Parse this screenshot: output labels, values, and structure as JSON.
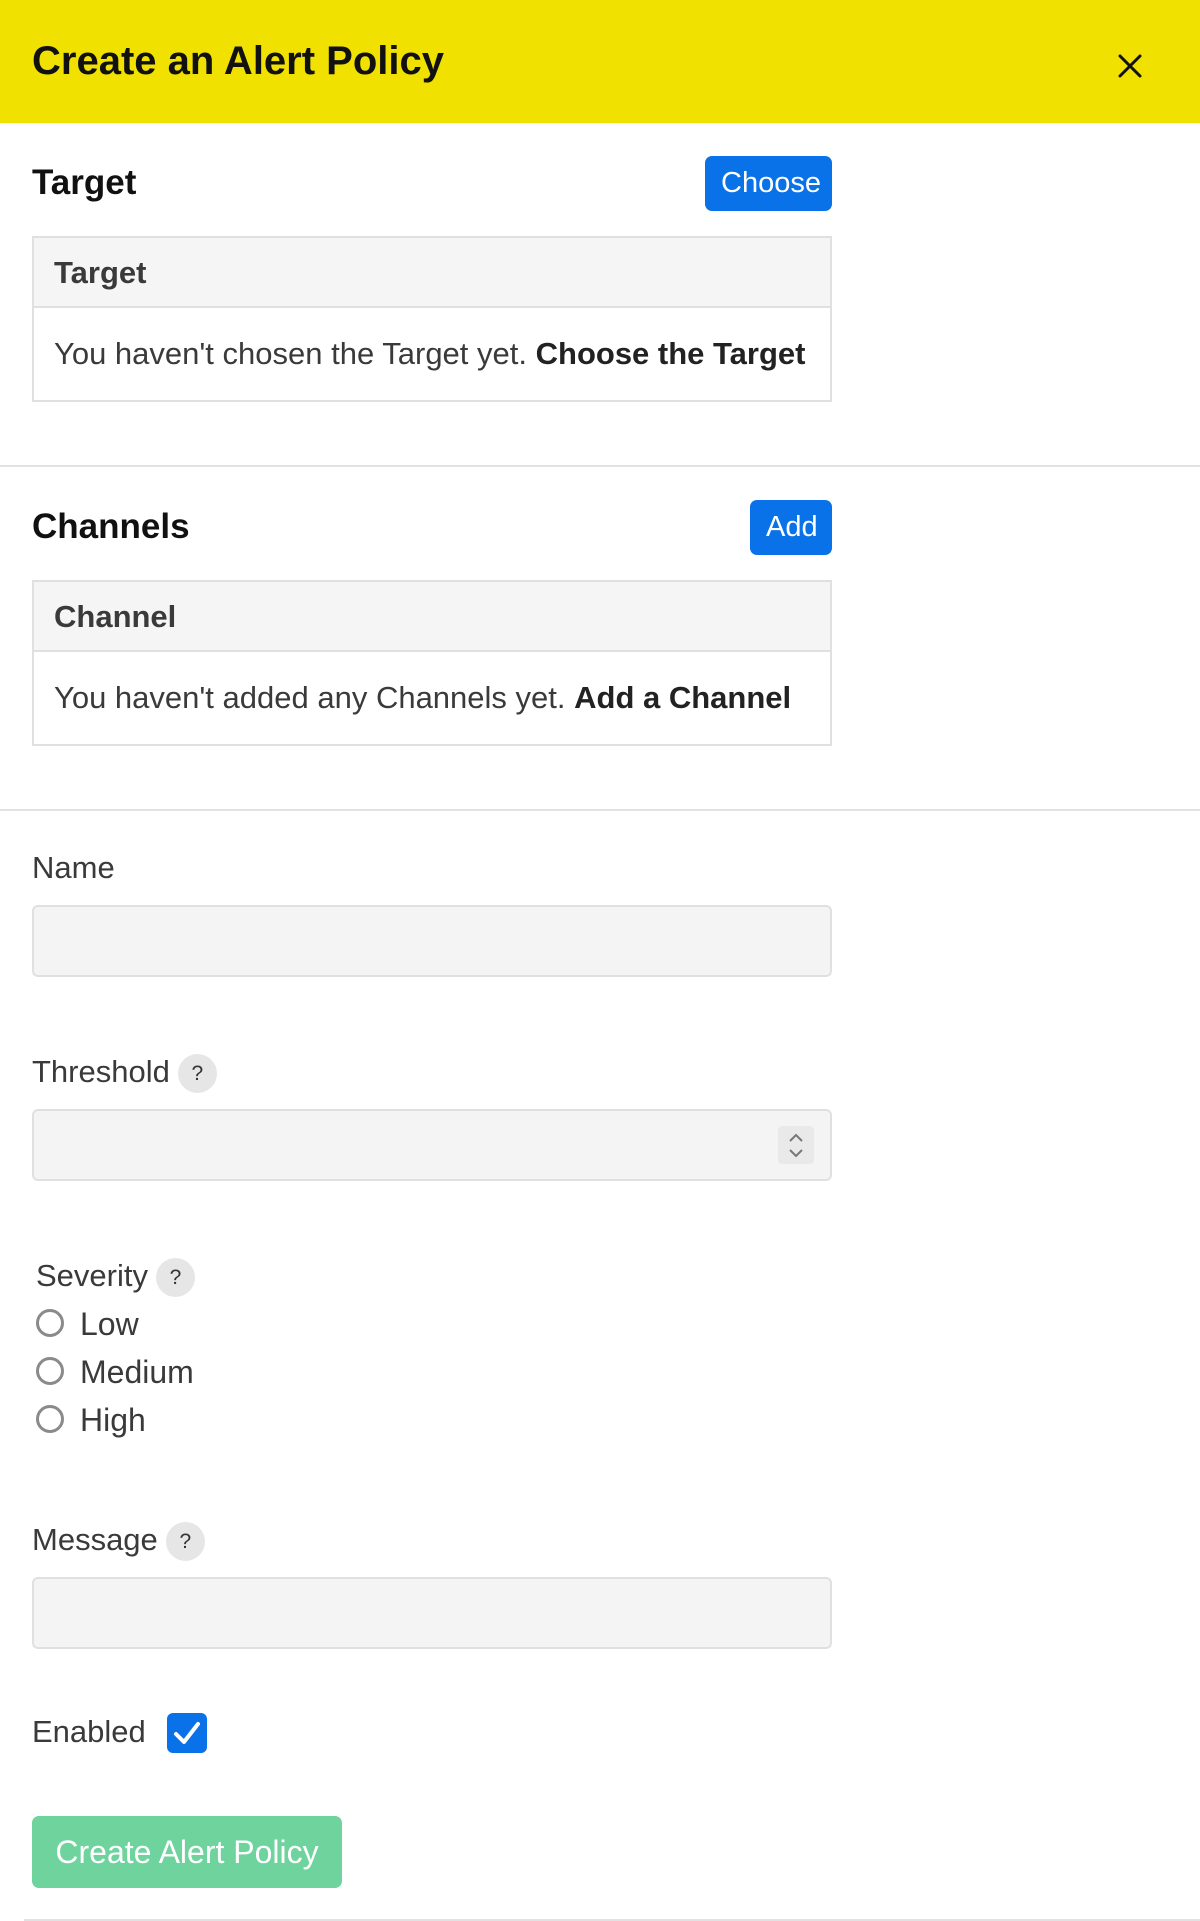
{
  "header": {
    "title": "Create an Alert Policy",
    "close_icon": "close-icon",
    "background_color": "#f1e100"
  },
  "target": {
    "heading": "Target",
    "button_label": "Choose",
    "table_header": "Target",
    "empty_text": "You haven't chosen the Target yet.",
    "empty_link": "Choose the Target"
  },
  "channels": {
    "heading": "Channels",
    "button_label": "Add",
    "table_header": "Channel",
    "empty_text": "You haven't added any Channels yet.",
    "empty_link": "Add a Channel"
  },
  "form": {
    "name": {
      "label": "Name",
      "value": ""
    },
    "threshold": {
      "label": "Threshold",
      "help": "?",
      "value": ""
    },
    "severity": {
      "label": "Severity",
      "help": "?",
      "options": [
        "Low",
        "Medium",
        "High"
      ],
      "selected": null
    },
    "message": {
      "label": "Message",
      "help": "?",
      "value": ""
    },
    "enabled": {
      "label": "Enabled",
      "checked": true
    },
    "submit_label": "Create Alert Policy"
  },
  "colors": {
    "primary": "#0a72e8",
    "submit": "#6fd39e",
    "header": "#f1e100"
  }
}
